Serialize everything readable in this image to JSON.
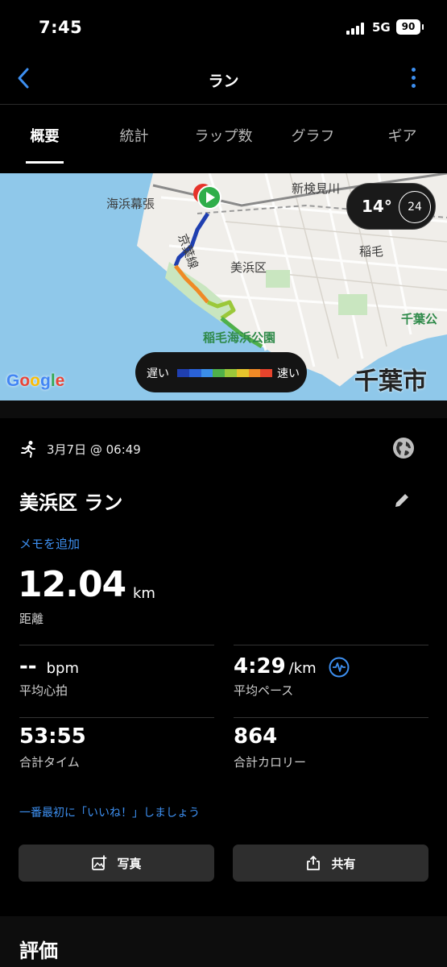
{
  "status": {
    "time": "7:45",
    "network": "5G",
    "battery": "90"
  },
  "nav": {
    "title": "ラン"
  },
  "tabs": [
    {
      "label": "概要",
      "active": true
    },
    {
      "label": "統計",
      "active": false
    },
    {
      "label": "ラップ数",
      "active": false
    },
    {
      "label": "グラフ",
      "active": false
    },
    {
      "label": "ギア",
      "active": false
    }
  ],
  "map": {
    "labels": {
      "shinkemigawa": "新検見川",
      "kaihin_makuhari": "海浜幕張",
      "keiyo_line": "京葉線",
      "mihama": "美浜区",
      "inage": "稲毛",
      "inage_park": "稲毛海浜公園",
      "chiba_park": "千葉公",
      "chiba_city": "千葉市"
    },
    "weather": {
      "temp": "14°",
      "wind": "24"
    },
    "legend": {
      "slow": "遅い",
      "fast": "速い",
      "colors": [
        "#1f3fb0",
        "#2a62d8",
        "#3b8ee8",
        "#4fb04a",
        "#9bc83a",
        "#e6c42c",
        "#ef8a26",
        "#e6442c"
      ]
    },
    "attribution": "Google"
  },
  "summary": {
    "date": "3月7日 @ 06:49",
    "title": "美浜区 ラン",
    "add_memo": "メモを追加",
    "distance": "12.04",
    "distance_unit": "km",
    "distance_label": "距離",
    "avg_hr": "--",
    "avg_hr_unit": "bpm",
    "avg_hr_label": "平均心拍",
    "avg_pace": "4:29",
    "avg_pace_unit": "/km",
    "avg_pace_label": "平均ペース",
    "total_time": "53:55",
    "total_time_label": "合計タイム",
    "calories": "864",
    "calories_label": "合計カロリー",
    "like_prompt": "一番最初に「いいね！」しましょう",
    "photo_button": "写真",
    "share_button": "共有"
  },
  "rating": {
    "title": "評価"
  }
}
